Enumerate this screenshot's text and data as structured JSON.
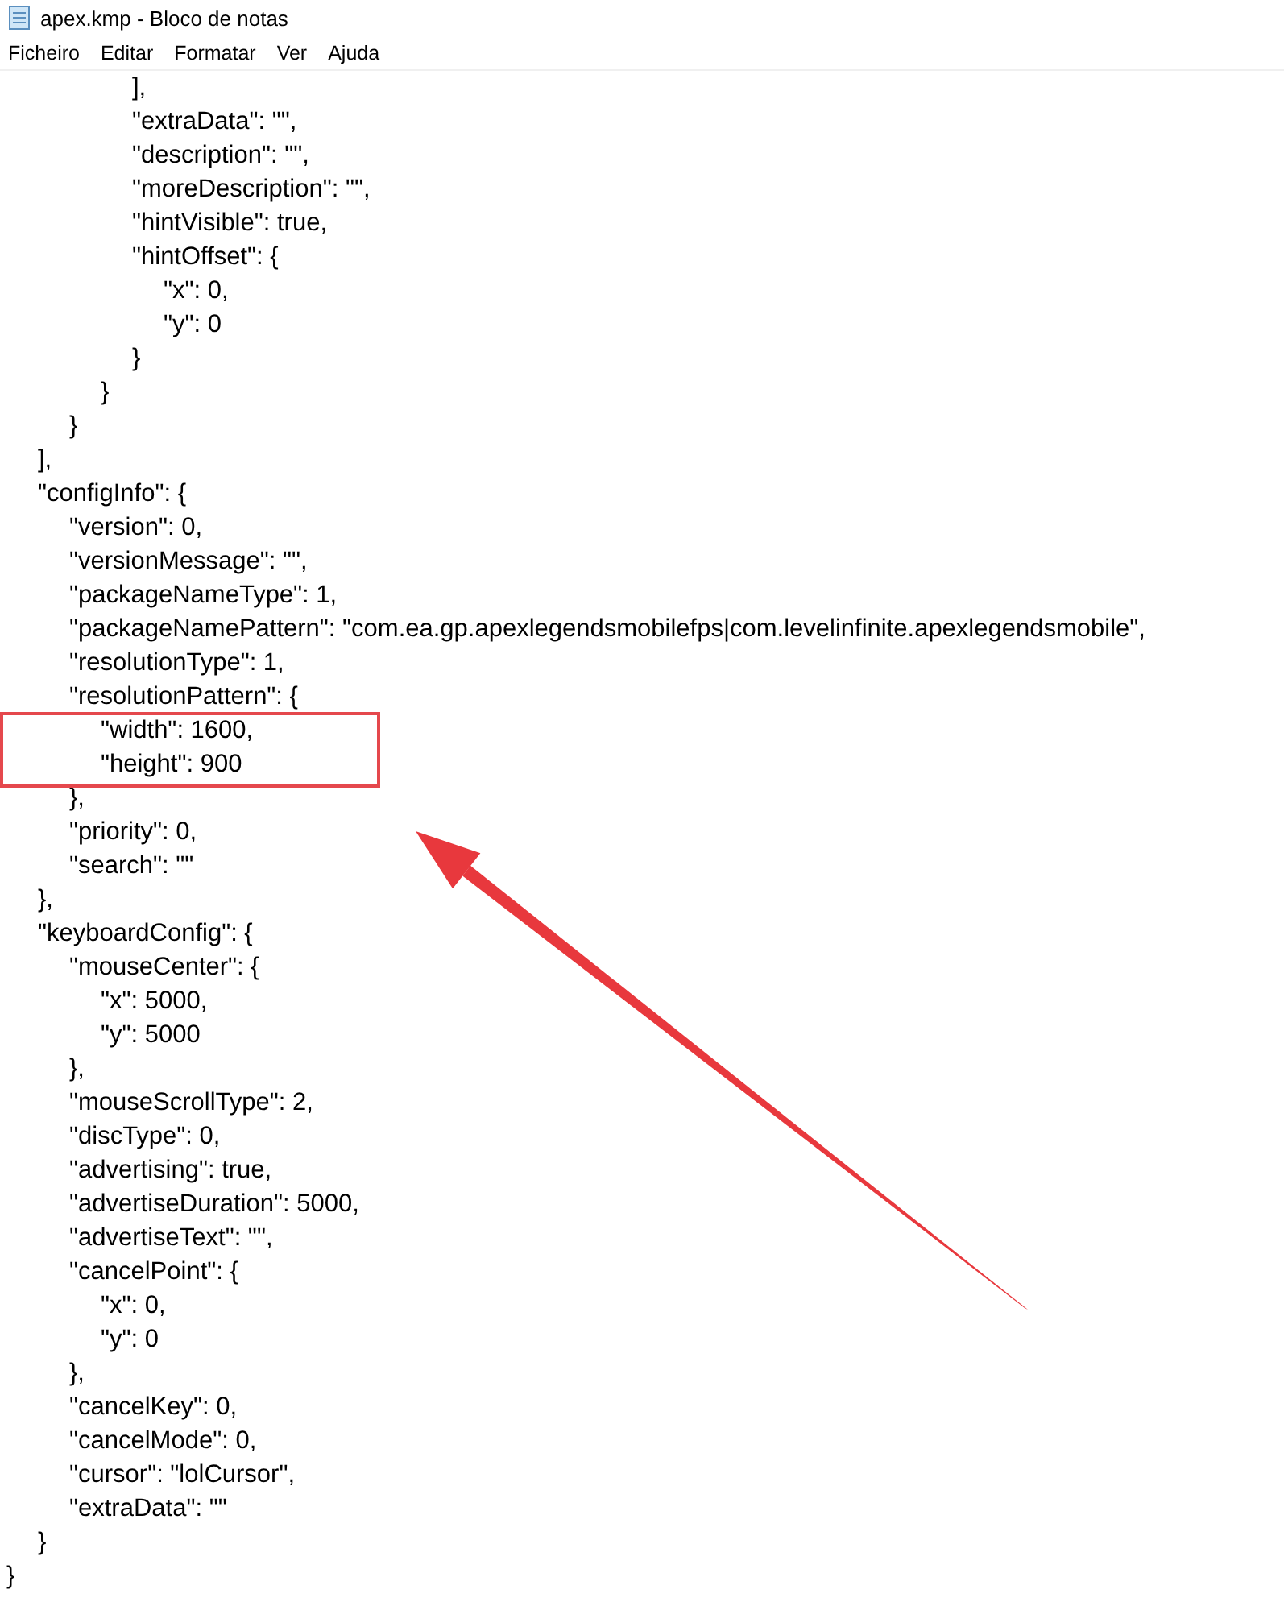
{
  "window": {
    "title": "apex.kmp - Bloco de notas"
  },
  "menu": [
    "Ficheiro",
    "Editar",
    "Formatar",
    "Ver",
    "Ajuda"
  ],
  "editor": {
    "lines": [
      "\t\t\t\t],",
      "\t\t\t\t\"extraData\": \"\",",
      "\t\t\t\t\"description\": \"\",",
      "\t\t\t\t\"moreDescription\": \"\",",
      "\t\t\t\t\"hintVisible\": true,",
      "\t\t\t\t\"hintOffset\": {",
      "\t\t\t\t\t\"x\": 0,",
      "\t\t\t\t\t\"y\": 0",
      "\t\t\t\t}",
      "\t\t\t}",
      "\t\t}",
      "\t],",
      "\t\"configInfo\": {",
      "\t\t\"version\": 0,",
      "\t\t\"versionMessage\": \"\",",
      "\t\t\"packageNameType\": 1,",
      "\t\t\"packageNamePattern\": \"com.ea.gp.apexlegendsmobilefps|com.levelinfinite.apexlegendsmobile\",",
      "\t\t\"resolutionType\": 1,",
      "\t\t\"resolutionPattern\": {",
      "\t\t\t\"width\": 1600,",
      "\t\t\t\"height\": 900",
      "\t\t},",
      "\t\t\"priority\": 0,",
      "\t\t\"search\": \"\"",
      "\t},",
      "\t\"keyboardConfig\": {",
      "\t\t\"mouseCenter\": {",
      "\t\t\t\"x\": 5000,",
      "\t\t\t\"y\": 5000",
      "\t\t},",
      "\t\t\"mouseScrollType\": 2,",
      "\t\t\"discType\": 0,",
      "\t\t\"advertising\": true,",
      "\t\t\"advertiseDuration\": 5000,",
      "\t\t\"advertiseText\": \"\",",
      "\t\t\"cancelPoint\": {",
      "\t\t\t\"x\": 0,",
      "\t\t\t\"y\": 0",
      "\t\t},",
      "\t\t\"cancelKey\": 0,",
      "\t\t\"cancelMode\": 0,",
      "\t\t\"cursor\": \"lolCursor\",",
      "\t\t\"extraData\": \"\"",
      "\t}",
      "}"
    ]
  }
}
